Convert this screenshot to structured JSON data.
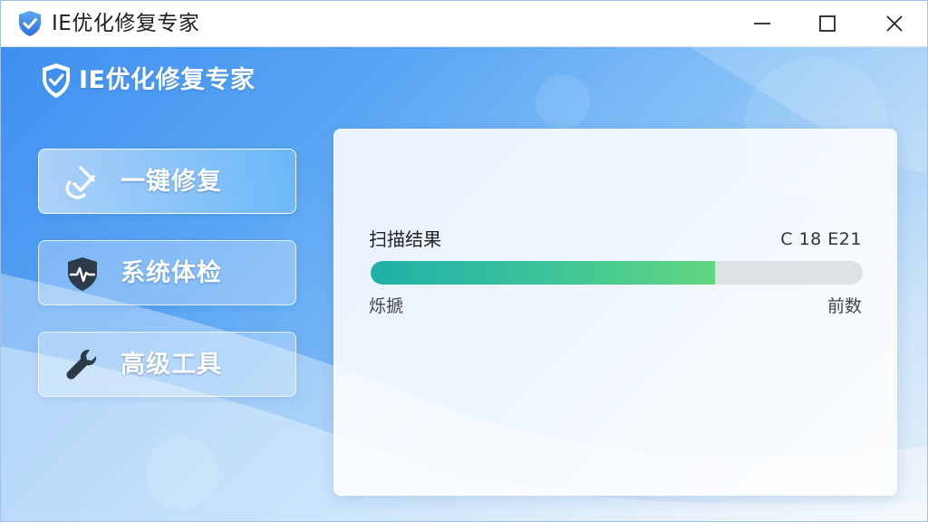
{
  "window": {
    "title": "IE优化修复专家",
    "logo_icon": "shield-check-icon",
    "controls": {
      "minimize_icon": "minimize-icon",
      "maximize_icon": "maximize-icon",
      "close_icon": "close-icon"
    }
  },
  "brand": {
    "title": "IE优化修复专家",
    "logo_icon": "shield-check-icon"
  },
  "nav": {
    "items": [
      {
        "label": "一键修复",
        "icon": "check-repair-icon",
        "active": true
      },
      {
        "label": "系统体检",
        "icon": "shield-pulse-icon",
        "active": false
      },
      {
        "label": "高级工具",
        "icon": "wrench-icon",
        "active": false
      }
    ]
  },
  "scan": {
    "title": "扫描结果",
    "counts": "C 18 E21",
    "progress_fraction": 0.7,
    "label_left": "烁搋",
    "label_right": "前数"
  },
  "colors": {
    "accent_blue": "#3f8ff0",
    "progress_start": "#1fb0a8",
    "progress_end": "#62d680",
    "track": "#dfe2e5"
  }
}
